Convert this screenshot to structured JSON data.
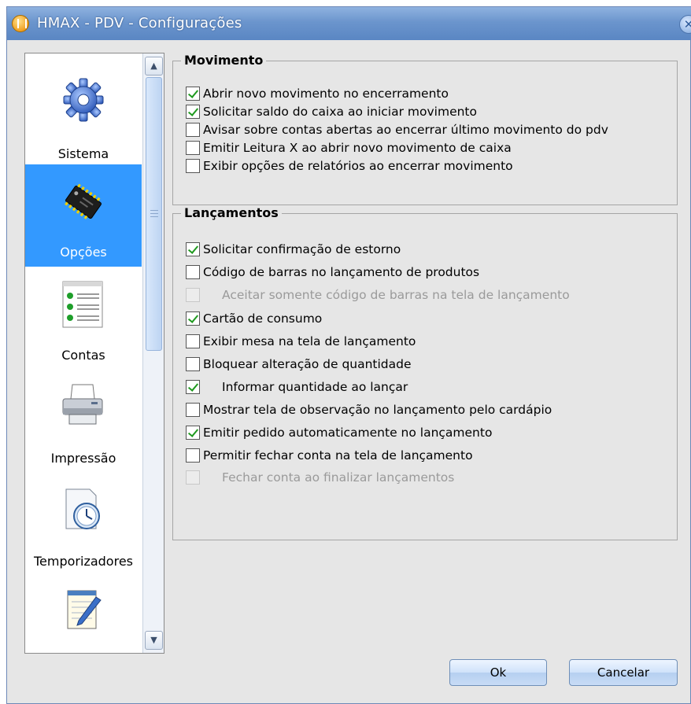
{
  "window": {
    "title": "HMAX - PDV - Configurações"
  },
  "sidebar": {
    "items": [
      {
        "label": "Sistema",
        "icon": "gear-icon",
        "active": false
      },
      {
        "label": "Opções",
        "icon": "chip-icon",
        "active": true
      },
      {
        "label": "Contas",
        "icon": "list-icon",
        "active": false
      },
      {
        "label": "Impressão",
        "icon": "printer-icon",
        "active": false
      },
      {
        "label": "Temporizadores",
        "icon": "clock-icon",
        "active": false
      },
      {
        "label": "",
        "icon": "notepad-icon",
        "active": false
      }
    ]
  },
  "movimento": {
    "title": "Movimento",
    "options": [
      {
        "label": "Abrir novo movimento no encerramento",
        "checked": true,
        "enabled": true
      },
      {
        "label": "Solicitar saldo do caixa ao iniciar movimento",
        "checked": true,
        "enabled": true
      },
      {
        "label": "Avisar sobre contas abertas ao encerrar último movimento do pdv",
        "checked": false,
        "enabled": true
      },
      {
        "label": "Emitir Leitura X ao abrir novo movimento de caixa",
        "checked": false,
        "enabled": true
      },
      {
        "label": "Exibir opções de relatórios ao encerrar movimento",
        "checked": false,
        "enabled": true
      }
    ]
  },
  "lancamentos": {
    "title": "Lançamentos",
    "options": [
      {
        "label": "Solicitar confirmação de estorno",
        "checked": true,
        "enabled": true
      },
      {
        "label": "Código de barras no lançamento de produtos",
        "checked": false,
        "enabled": true
      },
      {
        "label": "Aceitar somente código de barras na tela de lançamento",
        "checked": false,
        "enabled": false
      },
      {
        "label": "Cartão de consumo",
        "checked": true,
        "enabled": true
      },
      {
        "label": "Exibir mesa na tela de lançamento",
        "checked": false,
        "enabled": true
      },
      {
        "label": "Bloquear alteração de quantidade",
        "checked": false,
        "enabled": true
      },
      {
        "label": "Informar quantidade ao lançar",
        "checked": true,
        "enabled": true
      },
      {
        "label": "Mostrar tela de observação no lançamento pelo cardápio",
        "checked": false,
        "enabled": true
      },
      {
        "label": "Emitir pedido automaticamente no lançamento",
        "checked": true,
        "enabled": true
      },
      {
        "label": "Permitir fechar conta na tela de lançamento",
        "checked": false,
        "enabled": true
      },
      {
        "label": "Fechar conta ao finalizar lançamentos",
        "checked": false,
        "enabled": false
      }
    ]
  },
  "buttons": {
    "ok": "Ok",
    "cancel": "Cancelar"
  },
  "colors": {
    "titlebar": "#6b95cd",
    "selection": "#3399ff",
    "check": "#1f9a1f"
  }
}
